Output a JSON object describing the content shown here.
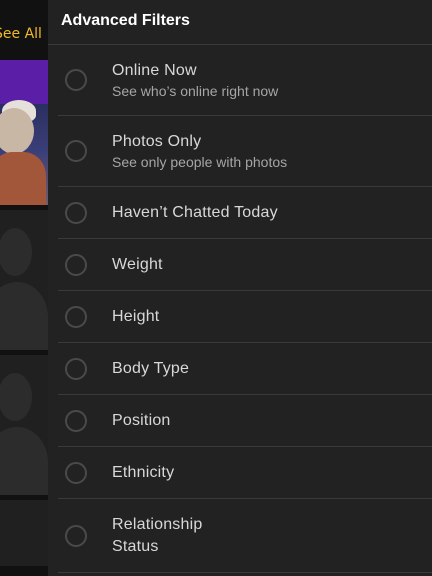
{
  "background": {
    "see_all": "See All"
  },
  "drawer": {
    "title": "Advanced Filters",
    "filters": [
      {
        "label": "Online Now",
        "sub": "See who’s online right now"
      },
      {
        "label": "Photos Only",
        "sub": "See only people with photos"
      },
      {
        "label": "Haven’t Chatted Today"
      },
      {
        "label": "Weight"
      },
      {
        "label": "Height"
      },
      {
        "label": "Body Type"
      },
      {
        "label": "Position"
      },
      {
        "label": "Ethnicity"
      },
      {
        "label": "Relationship Status"
      }
    ]
  },
  "colors": {
    "accent": "#f0b92a",
    "drawer_bg": "#222222",
    "divider": "#3a3a3a",
    "text_primary": "#d8d8d8",
    "text_secondary": "#a6a6a6"
  }
}
